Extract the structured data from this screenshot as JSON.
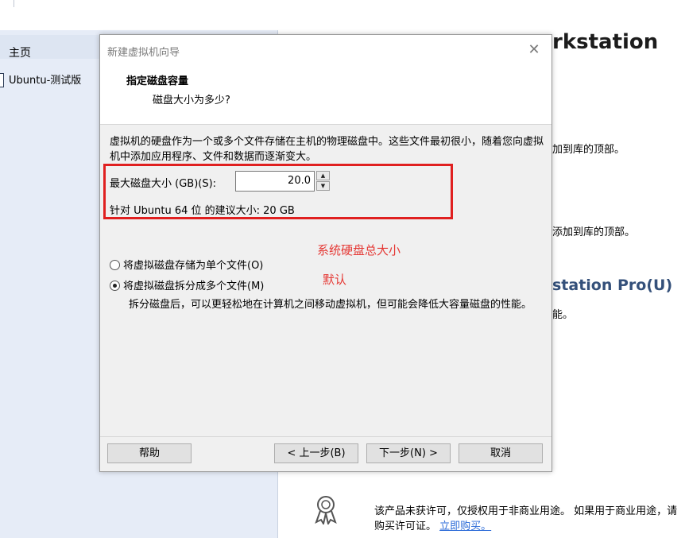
{
  "app": {
    "sidebar": {
      "home_label": "主页",
      "vm_label": "Ubuntu-测试版"
    },
    "main": {
      "title": "rkstation",
      "text1": "加到库的顶部。",
      "text2": "添加到库的顶部。",
      "pro_title": "station Pro(U)",
      "text3": "能。",
      "license_text": "该产品未获许可，仅授权用于非商业用途。 如果用于商业用途，请购买许可证。",
      "license_link": "立即购买。"
    }
  },
  "dialog": {
    "title": "新建虚拟机向导",
    "close_glyph": "✕",
    "heading": "指定磁盘容量",
    "subheading": "磁盘大小为多少?",
    "description": "虚拟机的硬盘作为一个或多个文件存储在主机的物理磁盘中。这些文件最初很小，随着您向虚拟机中添加应用程序、文件和数据而逐渐变大。",
    "size_label": "最大磁盘大小 (GB)(S):",
    "size_value": "20.0",
    "recommend": "针对 Ubuntu 64 位 的建议大小: 20 GB",
    "option_single": "将虚拟磁盘存储为单个文件(O)",
    "option_split": "将虚拟磁盘拆分成多个文件(M)",
    "option_split_selected": true,
    "split_desc": "拆分磁盘后，可以更轻松地在计算机之间移动虚拟机，但可能会降低大容量磁盘的性能。",
    "buttons": {
      "help": "帮助",
      "back": "< 上一步(B)",
      "next": "下一步(N) >",
      "cancel": "取消"
    }
  },
  "annotations": {
    "note1": "系统硬盘总大小",
    "note2": "默认",
    "color": "#e53935"
  },
  "icons": [
    "close-icon",
    "spin-up-icon",
    "spin-down-icon",
    "license-badge-icon",
    "vm-icon"
  ]
}
